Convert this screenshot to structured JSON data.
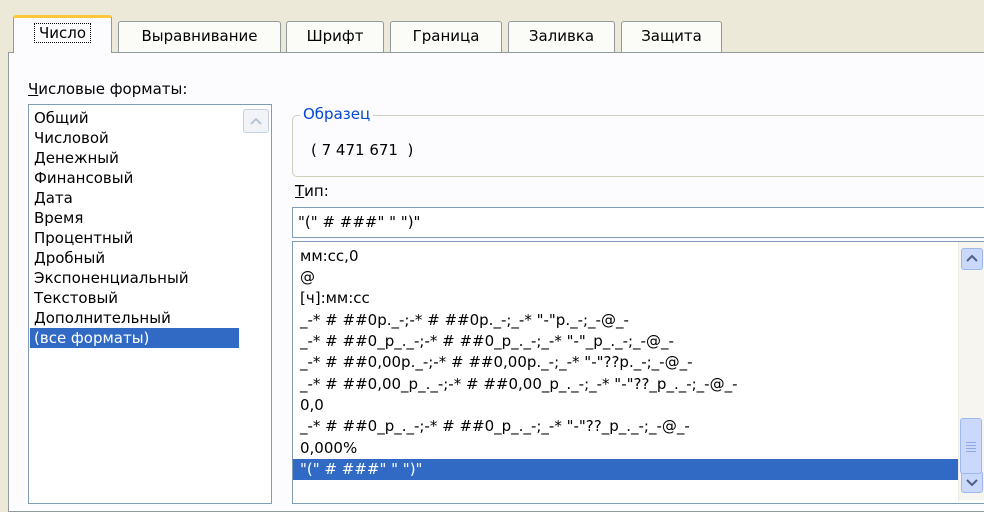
{
  "tabs": [
    {
      "label": "Число",
      "active": true
    },
    {
      "label": "Выравнивание",
      "active": false
    },
    {
      "label": "Шрифт",
      "active": false
    },
    {
      "label": "Граница",
      "active": false
    },
    {
      "label": "Заливка",
      "active": false
    },
    {
      "label": "Защита",
      "active": false
    }
  ],
  "categories": {
    "label_accel": "Ч",
    "label_rest": "исловые форматы:",
    "items": [
      "Общий",
      "Числовой",
      "Денежный",
      "Финансовый",
      "Дата",
      "Время",
      "Процентный",
      "Дробный",
      "Экспоненциальный",
      "Текстовый",
      "Дополнительный",
      "(все форматы)"
    ],
    "selected": "(все форматы)"
  },
  "sample": {
    "legend": "Образец",
    "value": "( 7 471 671  )"
  },
  "type": {
    "label_accel": "Т",
    "label_rest": "ип:",
    "value": "\"(\" # ###\" \" \")\""
  },
  "formats": {
    "items": [
      "мм:сс,0",
      "@",
      "[ч]:мм:сс",
      "_-* # ##0р._-;-* # ##0р._-;_-* \"-\"р._-;_-@_-",
      "_-* # ##0_р_._-;-* # ##0_р_._-;_-* \"-\"_р_._-;_-@_-",
      "_-* # ##0,00р._-;-* # ##0,00р._-;_-* \"-\"??р._-;_-@_-",
      "_-* # ##0,00_р_._-;-* # ##0,00_р_._-;_-* \"-\"??_р_._-;_-@_-",
      "0,0",
      "_-* # ##0_р_._-;-* # ##0_р_._-;_-* \"-\"??_р_._-;_-@_-",
      "0,000%",
      "\"(\" # ###\" \" \")\""
    ],
    "selected": "\"(\" # ###\" \" \")\""
  },
  "colors": {
    "selection": "#316ac5",
    "dialog_bg": "#ece9d8",
    "active_tab_accent": "#ffc83c",
    "group_legend": "#0046d5"
  }
}
